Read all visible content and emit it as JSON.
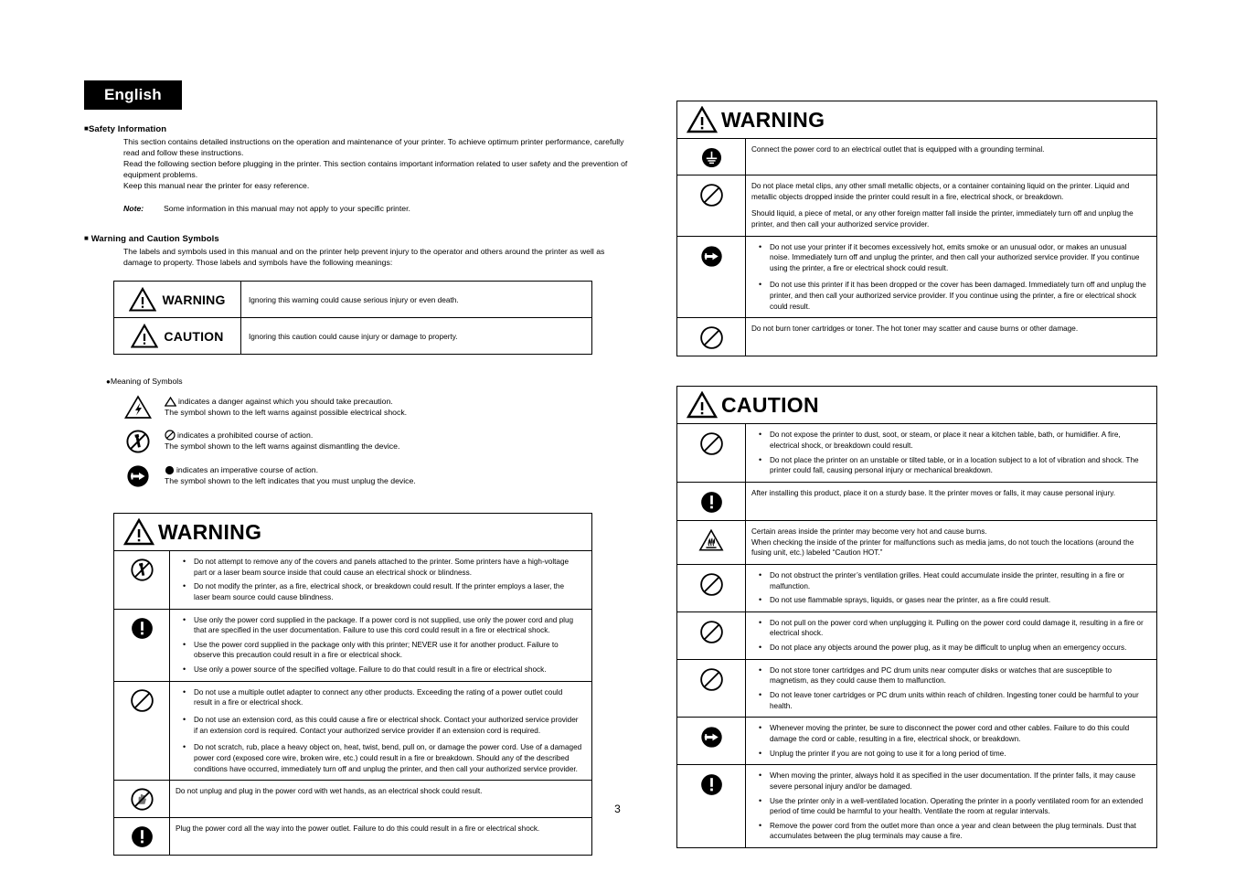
{
  "language_banner": "English",
  "page_number": "3",
  "safety_information": {
    "heading": "Safety Information",
    "paragraph1": "This section contains detailed instructions on the operation and maintenance of your printer. To achieve optimum printer performance, carefully read and follow these instructions.",
    "paragraph2": "Read the following section before plugging in the printer. This section contains important information related to user safety and the prevention of equipment problems.",
    "paragraph3": "Keep this manual near the printer for easy reference.",
    "note_label": "Note:",
    "note_text": "Some information in this manual may not apply to your specific printer."
  },
  "warning_caution_symbols": {
    "heading": "Warning and Caution Symbols",
    "intro": "The labels and symbols used in this manual and on the printer help prevent injury to the operator and others around the printer as well as damage to property. Those labels and symbols have the following meanings:",
    "rows": [
      {
        "label": "WARNING",
        "icon": "warning-triangle-icon",
        "description": "Ignoring this warning could cause serious injury or even death."
      },
      {
        "label": "CAUTION",
        "icon": "warning-triangle-icon",
        "description": "Ignoring this caution could cause injury or damage to property."
      }
    ]
  },
  "meaning_of_symbols": {
    "title": "Meaning of Symbols",
    "items": [
      {
        "icon": "electric-shock-triangle-icon",
        "line1": "indicates a danger against which you should take precaution.",
        "line2": "The symbol shown to the left warns against possible electrical shock."
      },
      {
        "icon": "no-disassembly-icon",
        "line1": "indicates a prohibited course of action.",
        "line2": "The symbol shown to the left warns against dismantling the device."
      },
      {
        "icon": "unplug-icon",
        "line1": "indicates an imperative course of action.",
        "line2": "The symbol shown to the left indicates that you must unplug the device."
      }
    ]
  },
  "warning_table_left": {
    "banner": "WARNING",
    "rows": [
      {
        "icon": "no-disassembly-icon",
        "bullets": [
          "Do not attempt to remove any of the covers and panels attached to the printer. Some printers have a high-voltage part or a laser beam source inside that could cause an electrical shock or blindness.",
          "Do not modify the printer, as a fire, electrical shock, or breakdown could result. If the printer employs a laser, the laser beam source could cause blindness."
        ]
      },
      {
        "icon": "imperative-exclamation-icon",
        "bullets": [
          "Use only the power cord supplied in the package. If a power cord is not supplied, use only the power cord and plug that are specified in the user documentation. Failure to use this cord could result in a fire or electrical shock.",
          "Use the power cord supplied in the package only with this printer; NEVER use it for another product. Failure to observe this precaution could result in a fire or electrical shock.",
          "Use only a power source of the specified voltage. Failure to do that could result in a fire or electrical shock."
        ]
      },
      {
        "icon": "prohibited-icon",
        "bullets": [
          "Do not use a multiple outlet adapter to connect any other products. Exceeding the rating of a power outlet could result in a fire or electrical shock.",
          "Do not use an extension cord, as this could cause a fire or electrical shock. Contact your authorized service provider if an extension cord is required. Contact your authorized service provider if an extension cord is required.",
          "Do not scratch, rub, place a heavy object on, heat, twist, bend, pull on, or damage the power cord. Use of a damaged power cord (exposed core wire, broken wire, etc.) could result in a fire or breakdown. Should any of the described conditions have occurred, immediately turn off and unplug the printer, and then call your authorized service provider."
        ]
      },
      {
        "icon": "no-wet-hands-icon",
        "paragraphs": [
          "Do not unplug and plug in the power cord with wet hands, as an electrical shock could result."
        ]
      },
      {
        "icon": "imperative-exclamation-icon",
        "paragraphs": [
          "Plug the power cord all the way into the power outlet. Failure to do this could result in a fire or electrical shock."
        ]
      }
    ]
  },
  "warning_table_right": {
    "banner": "WARNING",
    "rows": [
      {
        "icon": "grounding-icon",
        "paragraphs": [
          "Connect the power cord to an electrical outlet that is equipped with a grounding terminal."
        ]
      },
      {
        "icon": "prohibited-icon",
        "paragraphs": [
          "Do not place metal clips, any other small metallic objects, or a container containing liquid on the printer. Liquid and metallic objects dropped inside the printer could result in a fire, electrical shock, or breakdown.",
          "Should liquid, a piece of metal, or any other foreign matter fall inside the printer, immediately turn off and unplug the printer, and then call your authorized service provider."
        ]
      },
      {
        "icon": "unplug-icon",
        "bullets": [
          "Do not use your printer if it becomes excessively hot, emits smoke or an unusual odor, or makes an unusual noise. Immediately turn off and unplug the printer, and then call your authorized service provider. If you continue using the printer, a fire or electrical shock could result.",
          "Do not use this printer if it has been dropped or the cover has been damaged. Immediately turn off and unplug the printer, and then call your authorized service provider. If you continue using the printer, a fire or electrical shock could result."
        ]
      },
      {
        "icon": "prohibited-icon",
        "paragraphs": [
          "Do not burn toner cartridges or toner. The hot toner may scatter and cause burns or other damage."
        ]
      }
    ]
  },
  "caution_table_right": {
    "banner": "CAUTION",
    "rows": [
      {
        "icon": "prohibited-icon",
        "bullets": [
          "Do not expose the printer to dust, soot, or steam, or place it near a kitchen table, bath, or humidifier. A fire, electrical shock, or breakdown could result.",
          "Do not place the printer on an unstable or tilted table, or in a location subject to a lot of vibration and shock. The printer could fall, causing personal injury or mechanical breakdown."
        ]
      },
      {
        "icon": "imperative-exclamation-icon",
        "paragraphs": [
          "After installing this product, place it on a sturdy base. It the printer moves or falls, it may cause personal injury."
        ]
      },
      {
        "icon": "hot-surface-icon",
        "paragraphs": [
          "Certain areas inside the printer may become very hot and cause burns.\nWhen checking the inside of the printer for malfunctions such as media jams, do not touch the locations (around the fusing unit, etc.) labeled “Caution HOT.”"
        ]
      },
      {
        "icon": "prohibited-icon",
        "bullets": [
          "Do not obstruct the printer’s ventilation grilles. Heat could accumulate inside the printer, resulting in a fire or malfunction.",
          "Do not use flammable sprays, liquids, or gases near the printer, as a fire could result."
        ]
      },
      {
        "icon": "prohibited-icon",
        "bullets": [
          "Do not pull on the power cord when unplugging it. Pulling on the power cord could damage it, resulting in a fire or electrical shock.",
          "Do not place any objects around the power plug, as it may be difficult to unplug when an emergency occurs."
        ]
      },
      {
        "icon": "prohibited-icon",
        "bullets": [
          "Do not store toner cartridges and PC drum units near computer disks or watches that are susceptible to magnetism, as they could cause them to malfunction.",
          "Do not leave toner cartridges or PC drum units within reach of children. Ingesting toner could be harmful to your health."
        ]
      },
      {
        "icon": "unplug-icon",
        "bullets": [
          "Whenever moving the printer, be sure to disconnect the power cord and other cables. Failure to do this could damage the cord or cable, resulting in a fire, electrical shock, or breakdown.",
          "Unplug the printer if you are not going to use it for a long period of time."
        ]
      },
      {
        "icon": "imperative-exclamation-icon",
        "bullets": [
          "When moving the printer, always hold it as specified in the user documentation. If the printer falls, it may cause severe personal injury and/or be damaged.",
          "Use the printer only in a well-ventilated location. Operating the printer in a poorly ventilated room for an extended period of time could be harmful to your health. Ventilate the room at regular intervals.",
          "Remove the power cord from the outlet more than once a year and clean between the plug terminals. Dust that accumulates between the plug terminals may cause a fire."
        ]
      }
    ]
  },
  "colors": {
    "banner_bg": "#000000",
    "banner_fg": "#ffffff",
    "text": "#000000",
    "page_bg": "#ffffff"
  }
}
